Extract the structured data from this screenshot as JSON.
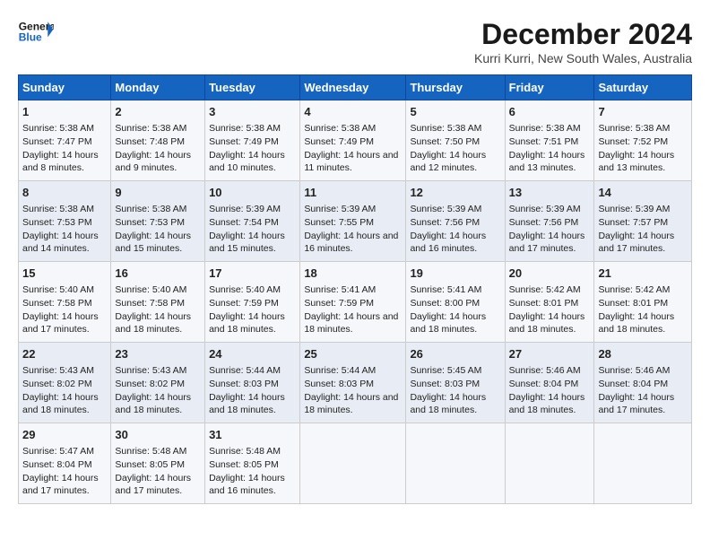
{
  "header": {
    "logo_line1": "General",
    "logo_line2": "Blue",
    "month_title": "December 2024",
    "location": "Kurri Kurri, New South Wales, Australia"
  },
  "days_of_week": [
    "Sunday",
    "Monday",
    "Tuesday",
    "Wednesday",
    "Thursday",
    "Friday",
    "Saturday"
  ],
  "weeks": [
    [
      {
        "day": "1",
        "sunrise": "5:38 AM",
        "sunset": "7:47 PM",
        "daylight": "14 hours and 8 minutes."
      },
      {
        "day": "2",
        "sunrise": "5:38 AM",
        "sunset": "7:48 PM",
        "daylight": "14 hours and 9 minutes."
      },
      {
        "day": "3",
        "sunrise": "5:38 AM",
        "sunset": "7:49 PM",
        "daylight": "14 hours and 10 minutes."
      },
      {
        "day": "4",
        "sunrise": "5:38 AM",
        "sunset": "7:49 PM",
        "daylight": "14 hours and 11 minutes."
      },
      {
        "day": "5",
        "sunrise": "5:38 AM",
        "sunset": "7:50 PM",
        "daylight": "14 hours and 12 minutes."
      },
      {
        "day": "6",
        "sunrise": "5:38 AM",
        "sunset": "7:51 PM",
        "daylight": "14 hours and 13 minutes."
      },
      {
        "day": "7",
        "sunrise": "5:38 AM",
        "sunset": "7:52 PM",
        "daylight": "14 hours and 13 minutes."
      }
    ],
    [
      {
        "day": "8",
        "sunrise": "5:38 AM",
        "sunset": "7:53 PM",
        "daylight": "14 hours and 14 minutes."
      },
      {
        "day": "9",
        "sunrise": "5:38 AM",
        "sunset": "7:53 PM",
        "daylight": "14 hours and 15 minutes."
      },
      {
        "day": "10",
        "sunrise": "5:39 AM",
        "sunset": "7:54 PM",
        "daylight": "14 hours and 15 minutes."
      },
      {
        "day": "11",
        "sunrise": "5:39 AM",
        "sunset": "7:55 PM",
        "daylight": "14 hours and 16 minutes."
      },
      {
        "day": "12",
        "sunrise": "5:39 AM",
        "sunset": "7:56 PM",
        "daylight": "14 hours and 16 minutes."
      },
      {
        "day": "13",
        "sunrise": "5:39 AM",
        "sunset": "7:56 PM",
        "daylight": "14 hours and 17 minutes."
      },
      {
        "day": "14",
        "sunrise": "5:39 AM",
        "sunset": "7:57 PM",
        "daylight": "14 hours and 17 minutes."
      }
    ],
    [
      {
        "day": "15",
        "sunrise": "5:40 AM",
        "sunset": "7:58 PM",
        "daylight": "14 hours and 17 minutes."
      },
      {
        "day": "16",
        "sunrise": "5:40 AM",
        "sunset": "7:58 PM",
        "daylight": "14 hours and 18 minutes."
      },
      {
        "day": "17",
        "sunrise": "5:40 AM",
        "sunset": "7:59 PM",
        "daylight": "14 hours and 18 minutes."
      },
      {
        "day": "18",
        "sunrise": "5:41 AM",
        "sunset": "7:59 PM",
        "daylight": "14 hours and 18 minutes."
      },
      {
        "day": "19",
        "sunrise": "5:41 AM",
        "sunset": "8:00 PM",
        "daylight": "14 hours and 18 minutes."
      },
      {
        "day": "20",
        "sunrise": "5:42 AM",
        "sunset": "8:01 PM",
        "daylight": "14 hours and 18 minutes."
      },
      {
        "day": "21",
        "sunrise": "5:42 AM",
        "sunset": "8:01 PM",
        "daylight": "14 hours and 18 minutes."
      }
    ],
    [
      {
        "day": "22",
        "sunrise": "5:43 AM",
        "sunset": "8:02 PM",
        "daylight": "14 hours and 18 minutes."
      },
      {
        "day": "23",
        "sunrise": "5:43 AM",
        "sunset": "8:02 PM",
        "daylight": "14 hours and 18 minutes."
      },
      {
        "day": "24",
        "sunrise": "5:44 AM",
        "sunset": "8:03 PM",
        "daylight": "14 hours and 18 minutes."
      },
      {
        "day": "25",
        "sunrise": "5:44 AM",
        "sunset": "8:03 PM",
        "daylight": "14 hours and 18 minutes."
      },
      {
        "day": "26",
        "sunrise": "5:45 AM",
        "sunset": "8:03 PM",
        "daylight": "14 hours and 18 minutes."
      },
      {
        "day": "27",
        "sunrise": "5:46 AM",
        "sunset": "8:04 PM",
        "daylight": "14 hours and 18 minutes."
      },
      {
        "day": "28",
        "sunrise": "5:46 AM",
        "sunset": "8:04 PM",
        "daylight": "14 hours and 17 minutes."
      }
    ],
    [
      {
        "day": "29",
        "sunrise": "5:47 AM",
        "sunset": "8:04 PM",
        "daylight": "14 hours and 17 minutes."
      },
      {
        "day": "30",
        "sunrise": "5:48 AM",
        "sunset": "8:05 PM",
        "daylight": "14 hours and 17 minutes."
      },
      {
        "day": "31",
        "sunrise": "5:48 AM",
        "sunset": "8:05 PM",
        "daylight": "14 hours and 16 minutes."
      },
      null,
      null,
      null,
      null
    ]
  ],
  "labels": {
    "sunrise": "Sunrise:",
    "sunset": "Sunset:",
    "daylight": "Daylight:"
  }
}
